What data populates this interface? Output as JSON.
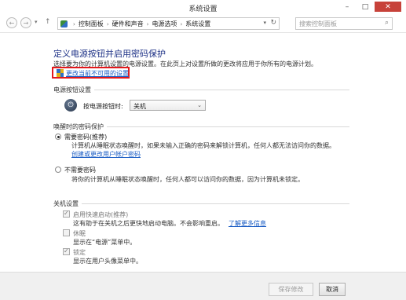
{
  "window": {
    "title": "系统设置",
    "minimize": "–",
    "maximize": "□",
    "close": "✕"
  },
  "nav": {
    "back": "←",
    "forward": "→",
    "dropdown": "▾",
    "up": "↑",
    "breadcrumb": [
      "控制面板",
      "硬件和声音",
      "电源选项",
      "系统设置"
    ],
    "sep": "›",
    "address_dropdown": "▾",
    "refresh": "↻",
    "search_placeholder": "搜索控制面板"
  },
  "page": {
    "heading": "定义电源按钮并启用密码保护",
    "intro": "选择要为你的计算机设置的电源设置。在此页上对设置所做的更改将应用于你所有的电源计划。",
    "change_unavailable_link": "更改当前不可用的设置"
  },
  "power_button": {
    "section": "电源按钮设置",
    "label": "按电源按钮时:",
    "value": "关机",
    "arrow": "⌄"
  },
  "password": {
    "section": "唤醒时的密码保护",
    "require": {
      "label": "需要密码(推荐)",
      "desc": "计算机从睡眠状态唤醒时，如果未输入正确的密码来解锁计算机，任何人都无法访问你的数据。",
      "link": "创建或更改用户帐户密码",
      "selected": true
    },
    "no_require": {
      "label": "不需要密码",
      "desc": "将你的计算机从睡眠状态唤醒时，任何人都可以访问你的数据，因为计算机未锁定。",
      "selected": false
    }
  },
  "shutdown": {
    "section": "关机设置",
    "fast_startup": {
      "label": "启用快速启动(推荐)",
      "desc": "这有助于在关机之后更快地启动电脑。不会影响重启。",
      "link": "了解更多信息",
      "checked": true
    },
    "hibernate": {
      "label": "休眠",
      "desc": "显示在“电源”菜单中。",
      "checked": false
    },
    "lock": {
      "label": "锁定",
      "desc": "显示在用户头像菜单中。",
      "checked": true
    }
  },
  "footer": {
    "save": "保存修改",
    "cancel": "取消"
  },
  "colors": {
    "heading": "#1e3287",
    "link": "#1a5cc4",
    "highlight": "#e3181b",
    "close": "#c7423a"
  }
}
